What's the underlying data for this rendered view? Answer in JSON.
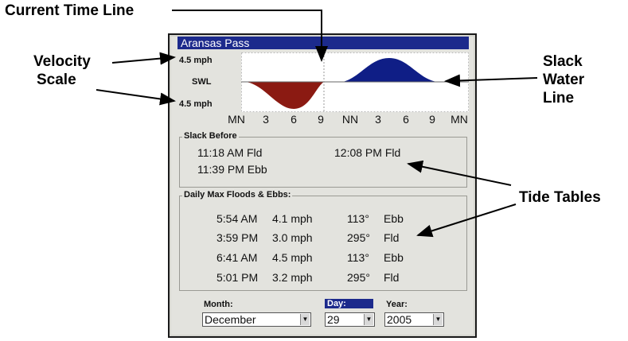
{
  "callouts": {
    "current_time_line": "Current Time Line",
    "velocity_scale_1": "Velocity",
    "velocity_scale_2": "Scale",
    "slack_water_1": "Slack",
    "slack_water_2": "Water",
    "slack_water_3": "Line",
    "tide_tables": "Tide Tables"
  },
  "window": {
    "title": "Aransas Pass"
  },
  "graph": {
    "scale_top": "4.5 mph",
    "scale_mid": "SWL",
    "scale_bottom": "4.5 mph",
    "ticks": [
      "MN",
      "3",
      "6",
      "9",
      "NN",
      "3",
      "6",
      "9",
      "MN"
    ],
    "ebb_color": "#8b1a12",
    "flood_color": "#0f1e86",
    "current_time_fraction": 0.5
  },
  "slack_before": {
    "title": "Slack Before",
    "entries": [
      "11:18 AM Fld",
      "11:39 PM Ebb",
      "12:08 PM Fld"
    ]
  },
  "daily_max": {
    "title": "Daily Max Floods & Ebbs:",
    "rows": [
      {
        "time": "5:54 AM",
        "speed": "4.1 mph",
        "dir": "113°",
        "type": "Ebb"
      },
      {
        "time": "3:59 PM",
        "speed": "3.0 mph",
        "dir": "295°",
        "type": "Fld"
      },
      {
        "time": "6:41 AM",
        "speed": "4.5 mph",
        "dir": "113°",
        "type": "Ebb"
      },
      {
        "time": "5:01 PM",
        "speed": "3.2 mph",
        "dir": "295°",
        "type": "Fld"
      }
    ]
  },
  "date_select": {
    "month_label": "Month:",
    "month_value": "December",
    "day_label": "Day:",
    "day_value": "29",
    "year_label": "Year:",
    "year_value": "2005"
  }
}
